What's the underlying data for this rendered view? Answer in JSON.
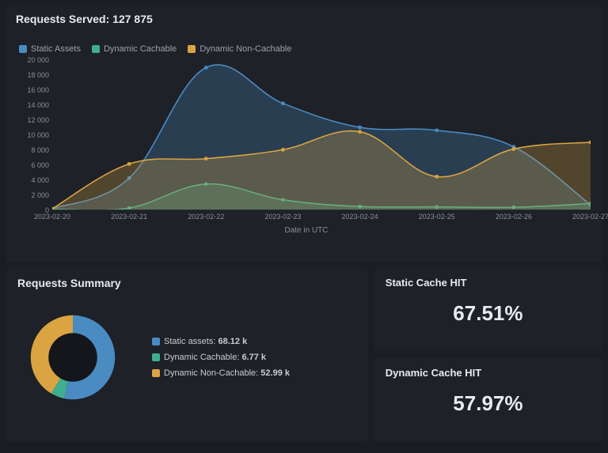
{
  "header": {
    "title": "Requests Served: 127 875"
  },
  "legend": {
    "static": "Static Assets",
    "dynamic_cachable": "Dynamic Cachable",
    "dynamic_noncachable": "Dynamic Non-Cachable"
  },
  "colors": {
    "static": "#4a8bc2",
    "dynamic_cachable": "#3fae8f",
    "dynamic_noncachable": "#d9a441"
  },
  "chart_data": {
    "type": "area",
    "xlabel": "Date in UTC",
    "ylabel": "",
    "ylim": [
      0,
      20000
    ],
    "categories": [
      "2023-02-20",
      "2023-02-21",
      "2023-02-22",
      "2023-02-23",
      "2023-02-24",
      "2023-02-25",
      "2023-02-26",
      "2023-02-27"
    ],
    "y_ticks": [
      0,
      2000,
      4000,
      6000,
      8000,
      10000,
      12000,
      14000,
      16000,
      18000,
      20000
    ],
    "series": [
      {
        "name": "Static Assets",
        "color": "#4a8bc2",
        "values": [
          100,
          4200,
          19000,
          14200,
          11000,
          10600,
          8400,
          600
        ]
      },
      {
        "name": "Dynamic Cachable",
        "color": "#3fae8f",
        "values": [
          50,
          200,
          3400,
          1300,
          400,
          350,
          300,
          800
        ]
      },
      {
        "name": "Dynamic Non-Cachable",
        "color": "#d9a441",
        "values": [
          100,
          6100,
          6800,
          8000,
          10400,
          4400,
          8100,
          9000
        ]
      }
    ]
  },
  "summary": {
    "title": "Requests Summary",
    "donut": {
      "type": "pie",
      "items": [
        {
          "label": "Static assets",
          "value": 68.12,
          "unit": "k",
          "color": "#4a8bc2"
        },
        {
          "label": "Dynamic Cachable",
          "value": 6.77,
          "unit": "k",
          "color": "#3fae8f"
        },
        {
          "label": "Dynamic Non-Cachable",
          "value": 52.99,
          "unit": "k",
          "color": "#d9a441"
        }
      ]
    }
  },
  "static_hit": {
    "label": "Static Cache HIT",
    "value": "67.51%"
  },
  "dynamic_hit": {
    "label": "Dynamic Cache HIT",
    "value": "57.97%"
  }
}
